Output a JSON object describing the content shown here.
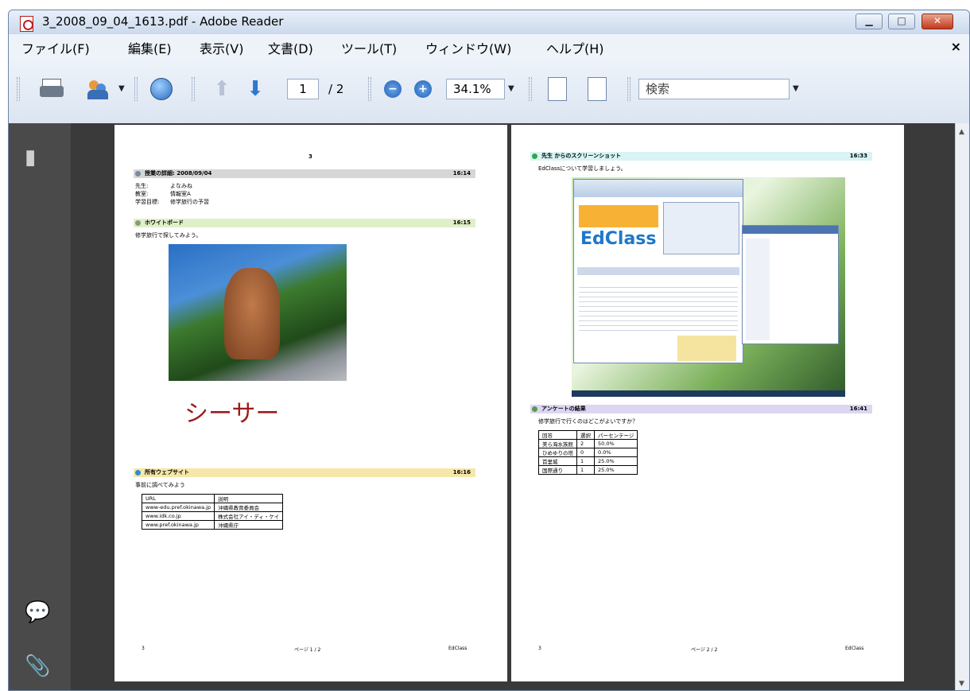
{
  "window": {
    "title": "3_2008_09_04_1613.pdf - Adobe Reader",
    "min_label": "▁",
    "max_label": "□",
    "close_label": "✕"
  },
  "menu": {
    "items": [
      "ファイル(F)",
      "編集(E)",
      "表示(V)",
      "文書(D)",
      "ツール(T)",
      "ウィンドウ(W)",
      "ヘルプ(H)"
    ],
    "close": "×"
  },
  "toolbar": {
    "page_current": "1",
    "page_total": "/ 2",
    "zoom": "34.1%",
    "search_placeholder": "検索"
  },
  "page1": {
    "number": "3",
    "lesson": {
      "title": "授業の詳細: 2008/09/04",
      "time": "16:14"
    },
    "info": [
      {
        "k": "先生:",
        "v": "よなみね"
      },
      {
        "k": "教室:",
        "v": "情報室A"
      },
      {
        "k": "学習目標:",
        "v": "修学旅行の予習"
      }
    ],
    "whiteboard": {
      "title": "ホワイトボード",
      "time": "16:15",
      "text": "修学旅行で探してみよう。"
    },
    "shisa": "シーサー",
    "websites": {
      "title": "所有ウェブサイト",
      "time": "16:16",
      "text": "事前に調べてみよう"
    },
    "table": {
      "headers": [
        "URL",
        "説明"
      ],
      "rows": [
        [
          "www-edu.pref.okinawa.jp",
          "沖縄県教育委員会"
        ],
        [
          "www.idk.co.jp",
          "株式会社アイ・ディ・ケイ"
        ],
        [
          "www.pref.okinawa.jp",
          "沖縄県庁"
        ]
      ]
    },
    "footer": {
      "left": "3",
      "center": "ページ 1 / 2",
      "right": "EdClass"
    }
  },
  "page2": {
    "screenshot": {
      "title": "先生 からのスクリーンショット",
      "time": "16:33",
      "text": "EdClassについて学習しましょう。"
    },
    "edclass": "EdClass",
    "survey": {
      "title": "アンケートの結果",
      "time": "16:41",
      "text": "修学旅行で行くのはどこがよいですか？"
    },
    "table": {
      "headers": [
        "回答",
        "選択",
        "パーセンテージ"
      ],
      "rows": [
        [
          "美ら海水族館",
          "2",
          "50.0%"
        ],
        [
          "ひめゆりの塔",
          "0",
          "0.0%"
        ],
        [
          "首里城",
          "1",
          "25.0%"
        ],
        [
          "国際通り",
          "1",
          "25.0%"
        ]
      ]
    },
    "footer": {
      "left": "3",
      "center": "ページ 2 / 2",
      "right": "EdClass"
    }
  },
  "colors": {
    "lesson_bar": "#d6d6d6",
    "whiteboard_bar": "#dff0c8",
    "website_bar": "#f6e7a8",
    "screenshot_bar": "#d8f4f4",
    "survey_bar": "#ddd6f2"
  }
}
